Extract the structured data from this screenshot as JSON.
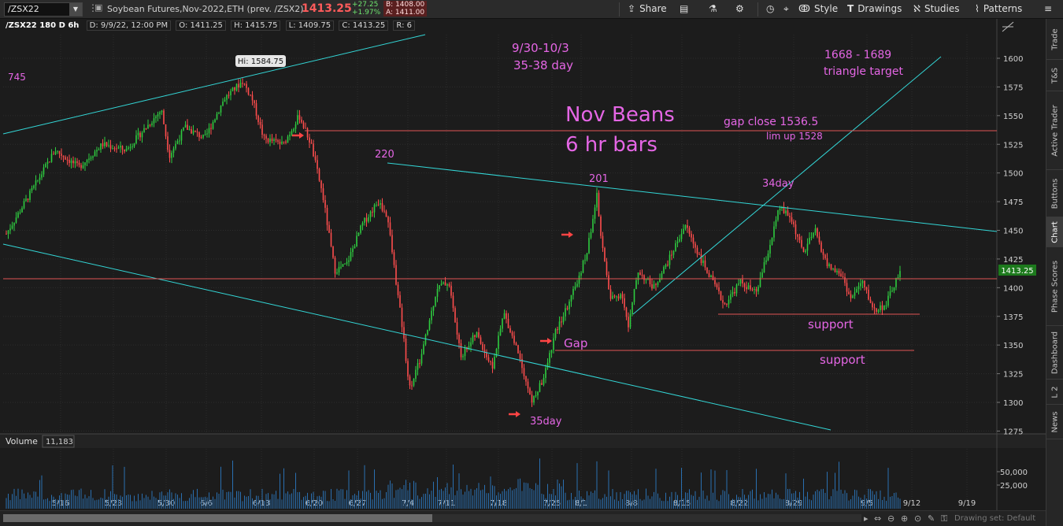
{
  "toolbar": {
    "symbol": "/ZSX22",
    "description": "Soybean Futures,Nov-2022,ETH (prev. /ZSX2)",
    "last": "1413.25",
    "change_abs": "+27.25",
    "change_pct": "+1.97%",
    "bid": "B: 1408.00",
    "ask": "A: 1411.00",
    "share_label": "Share",
    "style_label": "Style",
    "drawings_label": "Drawings",
    "studies_label": "Studies",
    "patterns_label": "Patterns"
  },
  "side_tabs": [
    "Trade",
    "T&S",
    "Active Trader",
    "Buttons",
    "Chart",
    "Phase Scores",
    "Dashboard",
    "L 2",
    "News"
  ],
  "side_tabs_active": "Chart",
  "info_bar": {
    "symbol_period": "/ZSX22 180 D 6h",
    "date": "D: 9/9/22, 12:00 PM",
    "open": "O: 1411.25",
    "high": "H: 1415.75",
    "low": "L: 1409.75",
    "close": "C: 1413.25",
    "range": "R: 6"
  },
  "price_axis": {
    "ticks": [
      "1600",
      "1575",
      "1550",
      "1525",
      "1500",
      "1475",
      "1450",
      "1425",
      "1400",
      "1375",
      "1350",
      "1325",
      "1300",
      "1275"
    ],
    "current_label": "1413.25"
  },
  "date_axis": [
    "5/16",
    "5/23",
    "5/30",
    "6/6",
    "6/13",
    "6/20",
    "6/27",
    "7/4",
    "7/11",
    "7/18",
    "7/25",
    "8/1",
    "8/8",
    "8/15",
    "8/22",
    "8/29",
    "9/5",
    "9/12",
    "9/19"
  ],
  "volume": {
    "label": "Volume",
    "value": "11,183",
    "ticks": [
      "50,000",
      "25,000"
    ]
  },
  "annotations": {
    "hi_marker": "Hi: 1584.75",
    "left_note": "745",
    "window_line1": "9/30-10/3",
    "window_line2": "35-38 day",
    "title_line1": "Nov Beans",
    "title_line2": "6  hr bars",
    "target_line1": "1668 - 1689",
    "target_line2": "triangle target",
    "gap_close": "gap close 1536.5",
    "lim_up": "lim up 1528",
    "peak_220": "220",
    "peak_201": "201",
    "peak_34day": "34day",
    "low_35day": "35day",
    "gap": "Gap",
    "support1": "support",
    "support2": "support"
  },
  "bottom_bar": {
    "drawing_set": "Drawing set: Default"
  },
  "colors": {
    "up_candle": "#2ecc40",
    "down_candle": "#ff4d4d",
    "trendline": "#33d6d6",
    "hline": "#e05555",
    "annotation": "#e566e5",
    "volume_bar": "#2a6fb0"
  }
}
